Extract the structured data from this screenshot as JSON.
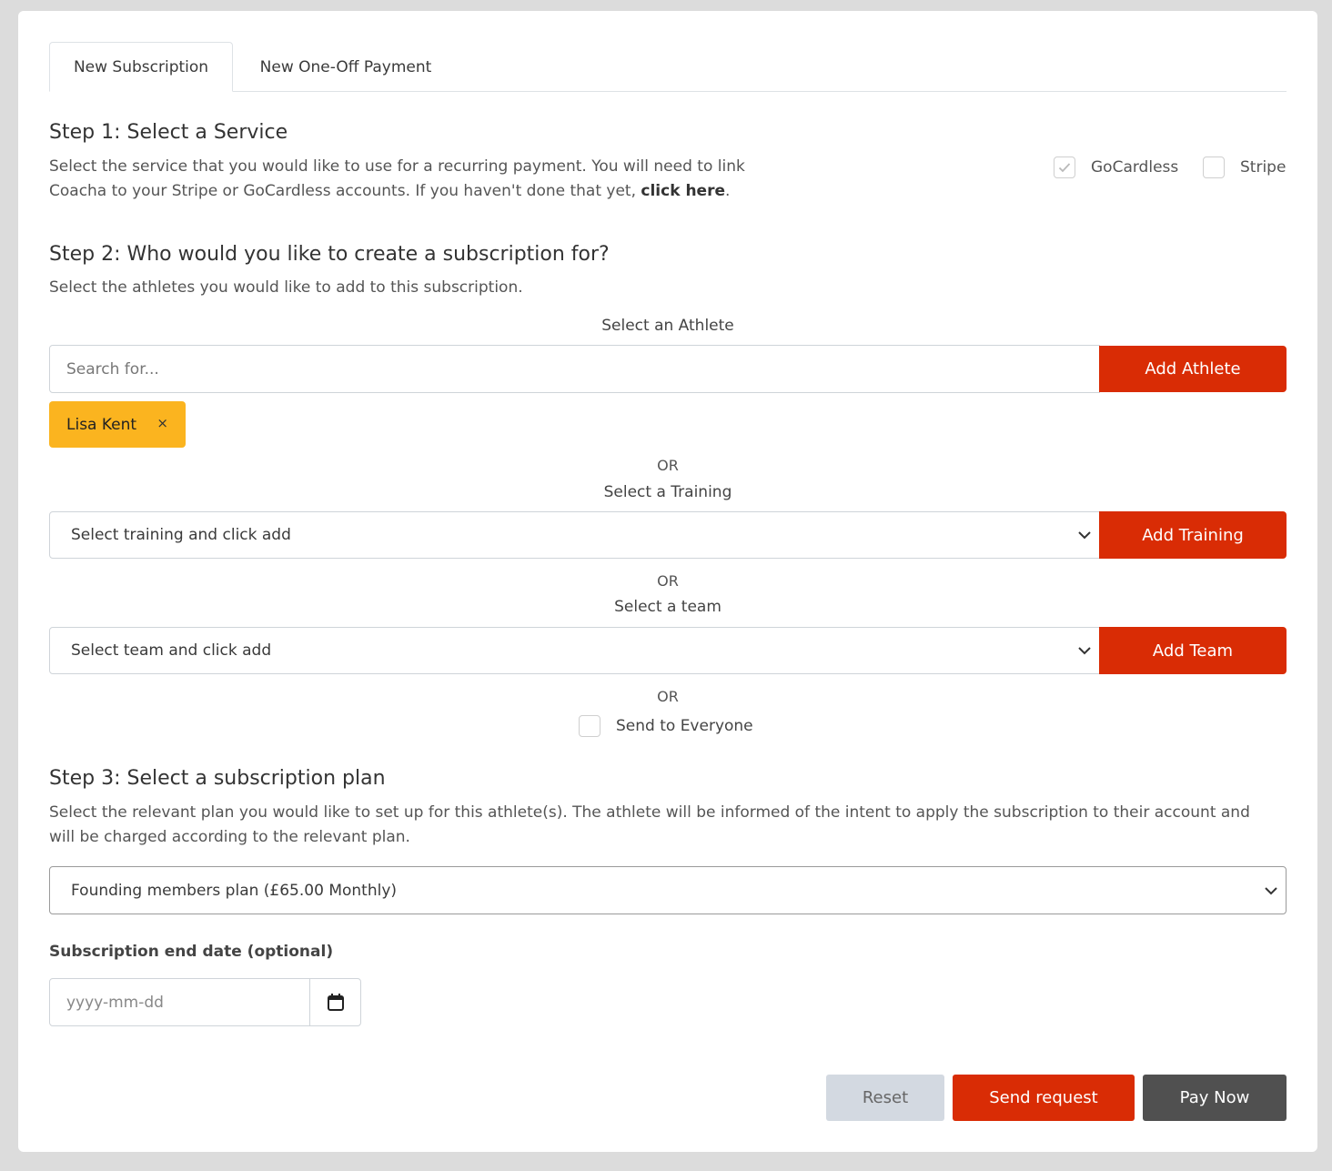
{
  "tabs": [
    {
      "label": "New Subscription",
      "active": true
    },
    {
      "label": "New One-Off Payment",
      "active": false
    }
  ],
  "step1": {
    "title": "Step 1: Select a Service",
    "desc_line1": "Select the service that you would like to use for a recurring payment. You will need to link",
    "desc_line2": "Coacha to your Stripe or GoCardless accounts. If you haven't done that yet, ",
    "link": "click here",
    "desc_end": ".",
    "options": [
      {
        "label": "GoCardless",
        "checked": true
      },
      {
        "label": "Stripe",
        "checked": false
      }
    ]
  },
  "step2": {
    "title": "Step 2: Who would you like to create a subscription for?",
    "desc": "Select the athletes you would like to add to this subscription.",
    "athlete_label": "Select an Athlete",
    "search_placeholder": "Search for...",
    "add_athlete": "Add Athlete",
    "selected_athlete": "Lisa Kent",
    "remove_symbol": "×",
    "or_label": "OR",
    "training_label": "Select a Training",
    "training_value": "Select training and click add",
    "add_training": "Add Training",
    "team_label": "Select a team",
    "team_value": "Select team and click add",
    "add_team": "Add Team",
    "send_everyone": "Send to Everyone"
  },
  "step3": {
    "title": "Step 3: Select a subscription plan",
    "desc_line1": "Select the relevant plan you would like to set up for this athlete(s). The athlete will be informed of the intent to apply the subscription to their account and",
    "desc_line2": "will be charged according to the relevant plan.",
    "plan_value": "Founding members plan (£65.00 Monthly)",
    "end_date_label": "Subscription end date (optional)",
    "date_placeholder": "yyyy-mm-dd"
  },
  "actions": {
    "reset": "Reset",
    "send_request": "Send request",
    "pay_now": "Pay Now"
  },
  "colors": {
    "primary": "#d92c05",
    "chip": "#fbb41f",
    "reset_bg": "#d3d9e1",
    "pay_bg": "#505050"
  },
  "icons": [
    "check-icon",
    "chevron-down-icon",
    "close-icon",
    "calendar-icon"
  ]
}
